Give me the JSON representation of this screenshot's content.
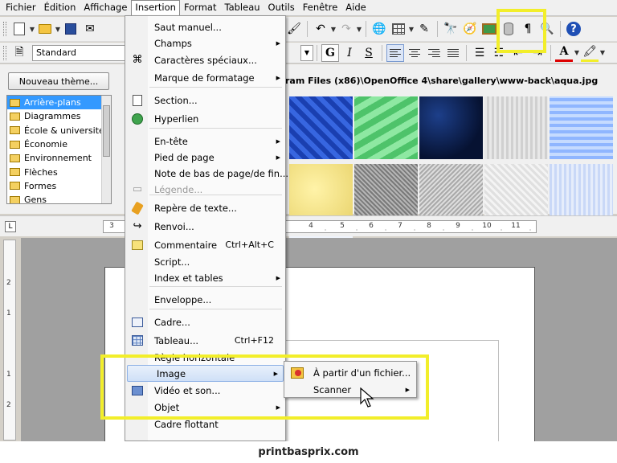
{
  "menubar": {
    "items": [
      "Fichier",
      "Édition",
      "Affichage",
      "Insertion",
      "Format",
      "Tableau",
      "Outils",
      "Fenêtre",
      "Aide"
    ]
  },
  "toolbar2": {
    "style_value": "Standard",
    "bold": "G",
    "italic": "I",
    "underline": "S",
    "font_color_glyph": "A"
  },
  "gallery": {
    "new_theme_label": "Nouveau thème...",
    "path": "ram Files (x86)\\OpenOffice 4\\share\\gallery\\www-back\\aqua.jpg",
    "themes": [
      "Arrière-plans",
      "Diagrammes",
      "École & université",
      "Économie",
      "Environnement",
      "Flèches",
      "Formes",
      "Gens"
    ],
    "selected_theme_index": 0
  },
  "ruler": {
    "labels": [
      "3",
      "4",
      "5",
      "6",
      "7",
      "8",
      "9",
      "10",
      "11"
    ],
    "vertical_labels": [
      "2",
      "1",
      "1",
      "2"
    ]
  },
  "insert_menu": {
    "items": [
      {
        "label": "Saut manuel...",
        "shortcut": "",
        "submenu": false,
        "disabled": false,
        "icon": ""
      },
      {
        "label": "Champs",
        "shortcut": "",
        "submenu": true,
        "disabled": false,
        "icon": ""
      },
      {
        "label": "Caractères spéciaux...",
        "shortcut": "",
        "submenu": false,
        "disabled": false,
        "icon": "omega-icon"
      },
      {
        "label": "Marque de formatage",
        "shortcut": "",
        "submenu": true,
        "disabled": false,
        "icon": ""
      },
      {
        "label": "Section...",
        "shortcut": "",
        "submenu": false,
        "disabled": false,
        "icon": "section-icon"
      },
      {
        "label": "Hyperlien",
        "shortcut": "",
        "submenu": false,
        "disabled": false,
        "icon": "hyperlink-icon"
      },
      {
        "label": "En-tête",
        "shortcut": "",
        "submenu": true,
        "disabled": false,
        "icon": ""
      },
      {
        "label": "Pied de page",
        "shortcut": "",
        "submenu": true,
        "disabled": false,
        "icon": ""
      },
      {
        "label": "Note de bas de page/de fin...",
        "shortcut": "",
        "submenu": false,
        "disabled": false,
        "icon": ""
      },
      {
        "label": "Légende...",
        "shortcut": "",
        "submenu": false,
        "disabled": true,
        "icon": "caption-icon"
      },
      {
        "label": "Repère de texte...",
        "shortcut": "",
        "submenu": false,
        "disabled": false,
        "icon": "bookmark-icon"
      },
      {
        "label": "Renvoi...",
        "shortcut": "",
        "submenu": false,
        "disabled": false,
        "icon": "cross-reference-icon"
      },
      {
        "label": "Commentaire",
        "shortcut": "Ctrl+Alt+C",
        "submenu": false,
        "disabled": false,
        "icon": "comment-icon"
      },
      {
        "label": "Script...",
        "shortcut": "",
        "submenu": false,
        "disabled": false,
        "icon": ""
      },
      {
        "label": "Index et tables",
        "shortcut": "",
        "submenu": true,
        "disabled": false,
        "icon": ""
      },
      {
        "label": "Enveloppe...",
        "shortcut": "",
        "submenu": false,
        "disabled": false,
        "icon": ""
      },
      {
        "label": "Cadre...",
        "shortcut": "",
        "submenu": false,
        "disabled": false,
        "icon": "frame-icon"
      },
      {
        "label": "Tableau...",
        "shortcut": "Ctrl+F12",
        "submenu": false,
        "disabled": false,
        "icon": "table-icon"
      },
      {
        "label": "Règle horizontale",
        "shortcut": "",
        "submenu": false,
        "disabled": false,
        "icon": ""
      },
      {
        "label": "Image",
        "shortcut": "",
        "submenu": true,
        "disabled": false,
        "icon": ""
      },
      {
        "label": "Vidéo et son...",
        "shortcut": "",
        "submenu": false,
        "disabled": false,
        "icon": "video-icon"
      },
      {
        "label": "Objet",
        "shortcut": "",
        "submenu": true,
        "disabled": false,
        "icon": ""
      },
      {
        "label": "Cadre flottant",
        "shortcut": "",
        "submenu": false,
        "disabled": false,
        "icon": ""
      }
    ],
    "highlighted_item": "Image"
  },
  "image_submenu": {
    "items": [
      {
        "label": "À partir d'un fichier...",
        "submenu": false
      },
      {
        "label": "Scanner",
        "submenu": true
      }
    ]
  },
  "colors": {
    "highlight_box": "#f2ee2a",
    "selection": "#3399ff"
  },
  "watermark": "printbasprix.com"
}
